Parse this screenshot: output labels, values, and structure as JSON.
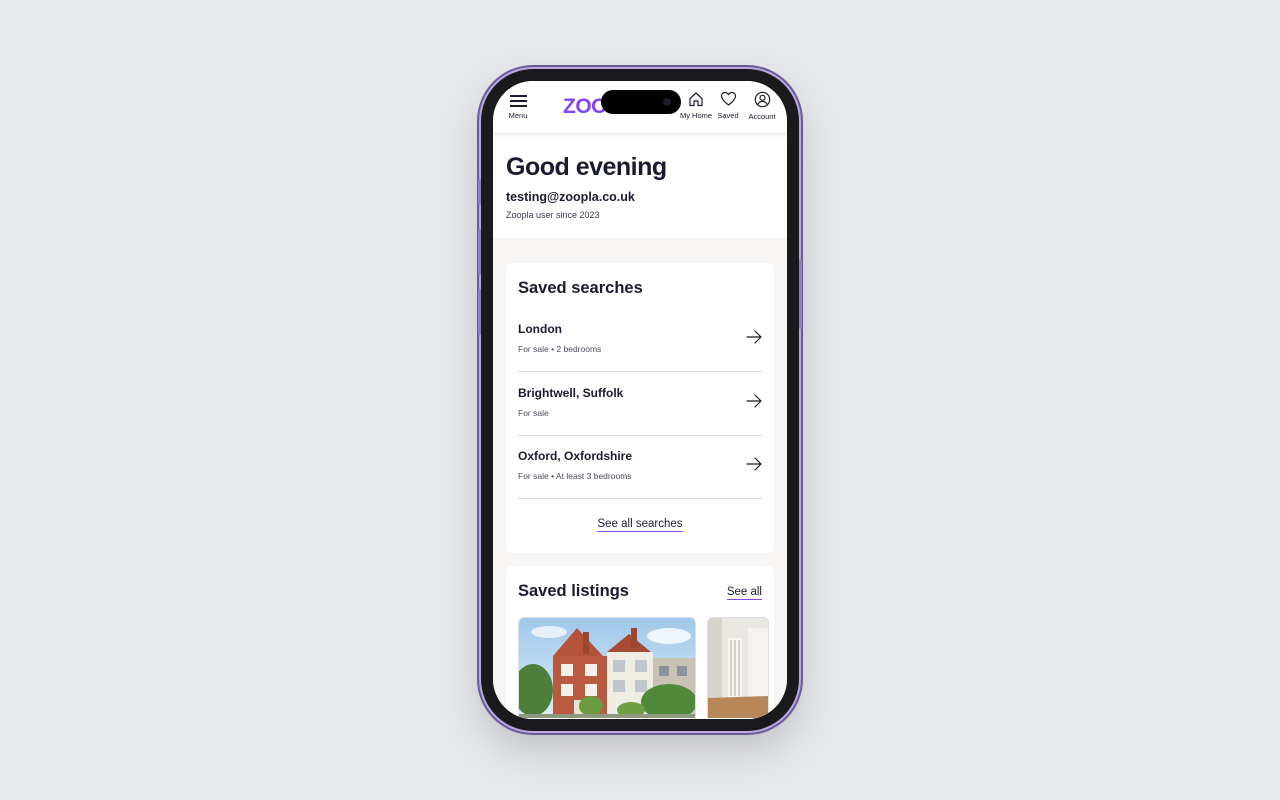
{
  "header": {
    "menu_label": "Menu",
    "logo_text": "ZOOPLA",
    "nav": {
      "home_label": "My Home",
      "saved_label": "Saved",
      "account_label": "Account"
    }
  },
  "greeting": {
    "title": "Good evening",
    "email": "testing@zoopla.co.uk",
    "since": "Zoopla user since 2023"
  },
  "saved_searches": {
    "title": "Saved searches",
    "items": [
      {
        "name": "London",
        "meta": "For sale • 2 bedrooms"
      },
      {
        "name": "Brightwell, Suffolk",
        "meta": "For sale"
      },
      {
        "name": "Oxford, Oxfordshire",
        "meta": "For sale • At least 3 bedrooms"
      }
    ],
    "see_all_label": "See all searches"
  },
  "saved_listings": {
    "title": "Saved listings",
    "see_all_label": "See all"
  },
  "colors": {
    "brand": "#8046f1",
    "text": "#1b1b2f",
    "background": "#e6e8ec",
    "content_bg": "#f7f6f4"
  }
}
